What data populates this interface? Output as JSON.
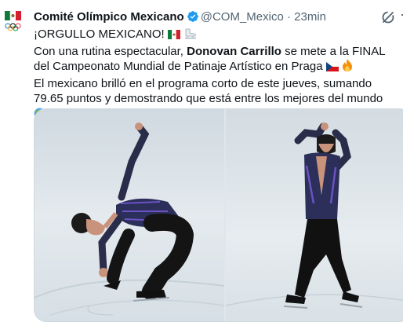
{
  "author": {
    "name": "Comité Olímpico Mexicano",
    "handle": "@COM_Mexico",
    "separator": "·",
    "time": "23min"
  },
  "post": {
    "line1": "¡ORGULLO MEXICANO!",
    "line2_start": "Con una rutina espectacular, ",
    "line2_bold": "Donovan Carrillo",
    "line2_end": " se mete a la FINAL del Campeonato Mundial de Patinaje Artístico en Praga",
    "line3": "El mexicano brilló en el programa corto de este jueves, sumando 79.65 puntos y demostrando que está entre los mejores del mundo"
  },
  "icons": [
    "olympic-mexico-logo",
    "verified-icon",
    "grok-icon",
    "more-icon",
    "mexico-flag-emoji",
    "skate-emoji",
    "czech-flag-emoji",
    "fire-emoji",
    "globe-emoji",
    "sparkles-emoji"
  ],
  "colors": {
    "verified": "#1d9bf0",
    "muted": "#536471",
    "text": "#0f1419"
  }
}
